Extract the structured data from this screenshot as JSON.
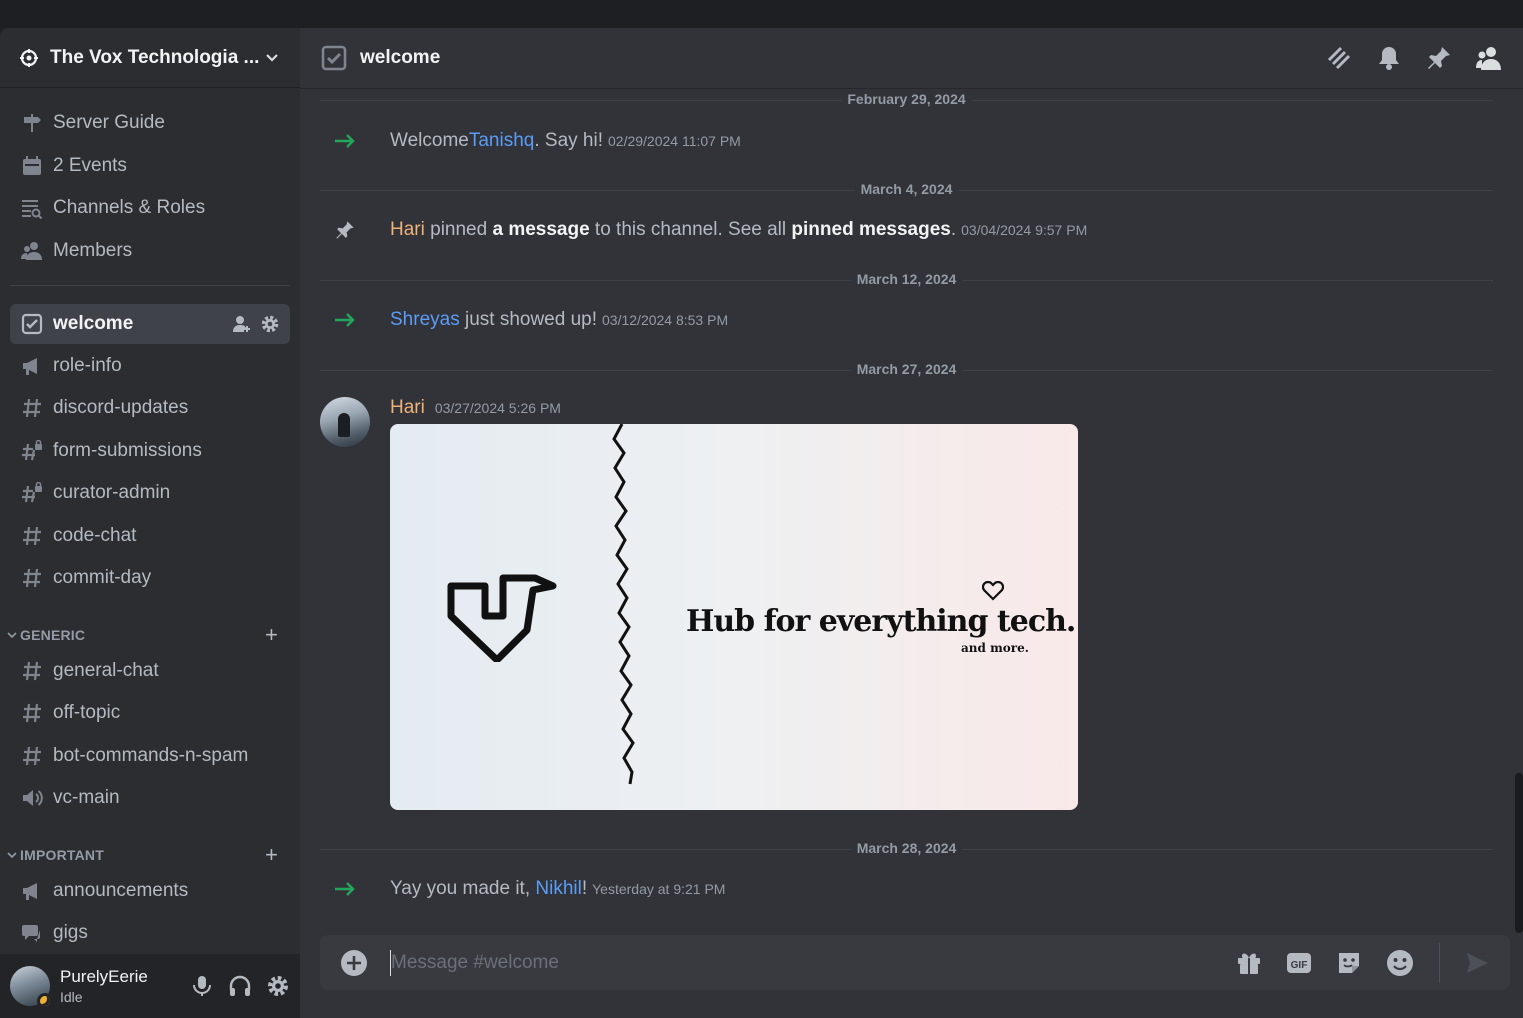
{
  "server": {
    "name": "The Vox Technologia ..."
  },
  "sidebar": {
    "top_items": [
      {
        "label": "Server Guide",
        "icon": "signpost-icon"
      },
      {
        "label": "2 Events",
        "icon": "calendar-icon"
      },
      {
        "label": "Channels & Roles",
        "icon": "channels-browse-icon"
      },
      {
        "label": "Members",
        "icon": "members-icon"
      }
    ],
    "channels": [
      {
        "label": "welcome",
        "icon": "rules-channel-icon",
        "active": true
      },
      {
        "label": "role-info",
        "icon": "announcement-icon"
      },
      {
        "label": "discord-updates",
        "icon": "hash-icon"
      },
      {
        "label": "form-submissions",
        "icon": "hash-locked-icon"
      },
      {
        "label": "curator-admin",
        "icon": "hash-locked-icon"
      },
      {
        "label": "code-chat",
        "icon": "hash-icon"
      },
      {
        "label": "commit-day",
        "icon": "hash-icon"
      }
    ],
    "categories": [
      {
        "name": "GENERIC",
        "channels": [
          {
            "label": "general-chat",
            "icon": "hash-icon"
          },
          {
            "label": "off-topic",
            "icon": "hash-icon"
          },
          {
            "label": "bot-commands-n-spam",
            "icon": "hash-icon"
          },
          {
            "label": "vc-main",
            "icon": "voice-icon"
          }
        ]
      },
      {
        "name": "IMPORTANT",
        "channels": [
          {
            "label": "announcements",
            "icon": "announcement-icon"
          },
          {
            "label": "gigs",
            "icon": "forum-icon"
          }
        ]
      }
    ]
  },
  "user": {
    "name": "PurelyEerie",
    "status": "Idle"
  },
  "channel": {
    "title": "welcome"
  },
  "messages": {
    "d1": "February 29, 2024",
    "m1": {
      "pre": "Welcome ",
      "mention": "Tanishq",
      "post": ". Say hi!",
      "ts": "02/29/2024 11:07 PM"
    },
    "d2": "March 4, 2024",
    "m2": {
      "author": "Hari",
      "t1": " pinned ",
      "link1": "a message",
      "t2": " to this channel. See all ",
      "link2": "pinned messages",
      "t3": ".",
      "ts": "03/04/2024 9:57 PM"
    },
    "d3": "March 12, 2024",
    "m3": {
      "mention": "Shreyas",
      "post": " just showed up!",
      "ts": "03/12/2024 8:53 PM"
    },
    "d4": "March 27, 2024",
    "m4": {
      "author": "Hari",
      "ts": "03/27/2024 5:26 PM",
      "image_text_1": "Hub for ",
      "image_text_hl": "everything",
      "image_text_2": " tech.",
      "image_sub": "and more."
    },
    "d5": "March 28, 2024",
    "m5": {
      "pre": "Yay you made it, ",
      "mention": "Nikhil",
      "post": "!",
      "ts": "Yesterday at 9:21 PM"
    }
  },
  "composer": {
    "placeholder": "Message #welcome"
  }
}
